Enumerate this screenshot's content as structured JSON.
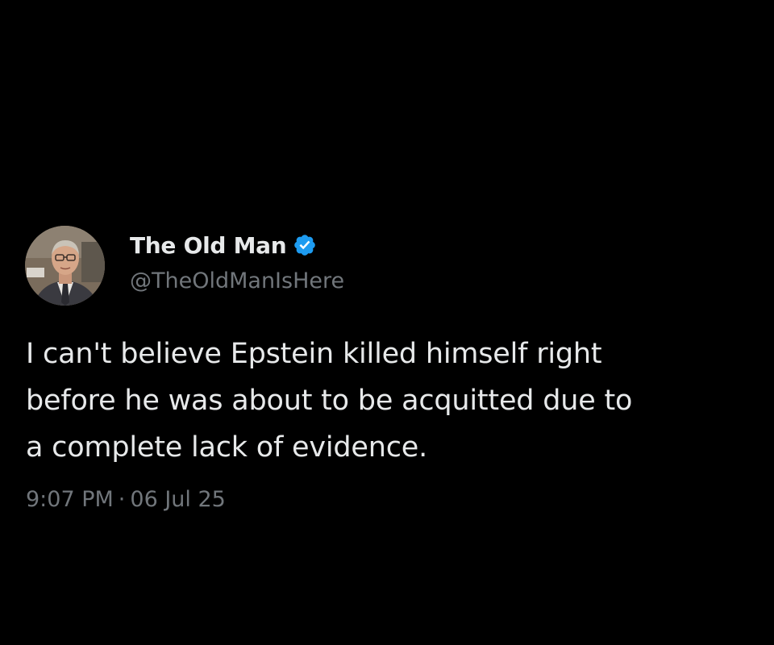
{
  "tweet": {
    "author": {
      "display_name": "The Old Man",
      "handle": "@TheOldManIsHere",
      "verified": true,
      "verified_badge_color": "#1d9bf0"
    },
    "text_lines": [
      "I can't believe Epstein killed himself right",
      "before he was about to be acquitted due to",
      "a complete lack of evidence."
    ],
    "time": "9:07 PM",
    "separator": "·",
    "date": "06 Jul 25"
  },
  "colors": {
    "background": "#000000",
    "primary_text": "#e7e9ea",
    "secondary_text": "#71767b"
  }
}
